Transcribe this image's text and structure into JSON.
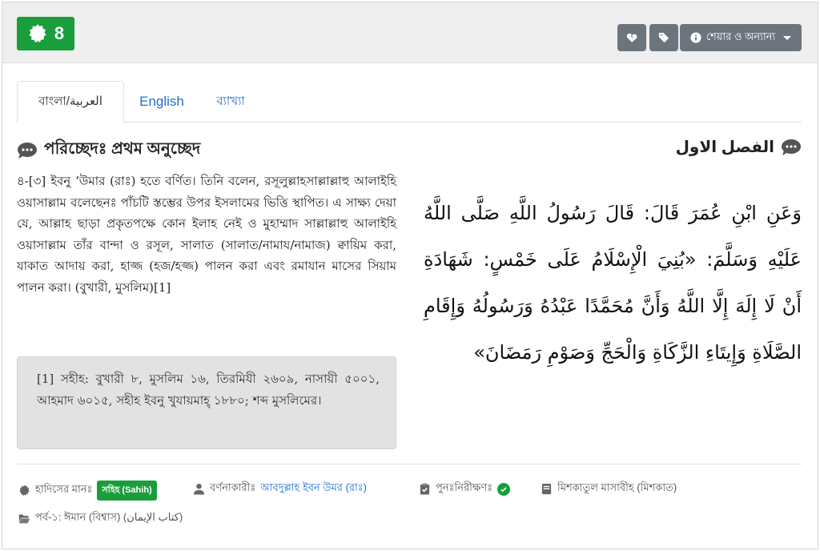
{
  "hadith_number": "8",
  "header_buttons": {
    "share_label": "শেয়ার ও অন্যান্য"
  },
  "tabs": [
    {
      "label": "বাংলা/العربية"
    },
    {
      "label": "English"
    },
    {
      "label": "ব্যাখ্যা"
    }
  ],
  "section": {
    "bn_title": "পরিচ্ছেদঃ প্রথম অনুচ্ছেদ",
    "ar_title": "الفصل الاول"
  },
  "bangla_text": "৪-[৩] ইবনু ‘উমার (রাঃ) হতে বর্ণিত। তিনি বলেন, রসূলুল্লাহসাল্লাল্লাহু আলাইহি ওয়াসাল্লাম বলেছেনঃ পাঁচটি স্তম্ভের উপর ইসলামের ভিত্তি স্থাপিত। এ সাক্ষ্য দেয়া যে, আল্লাহ ছাড়া প্রকৃতপক্ষে কোন ইলাহ নেই ও মুহাম্মাদ সাল্লাল্লাহু আলাইহি ওয়াসাল্লাম তাঁর বান্দা ও রসূল, সালাত (সালাত/নামায/নামাজ) ক্বায়িম করা, যাকাত আদায় করা, হাজ্জ (হজ/হজ্জ) পালন করা এবং রমাযান মাসের সিয়াম পালন করা। (বুখারী, মুসলিম)[1]",
  "footnote": "[1] সহীহ: বুখারী ৮, মুসলিম ১৬, তিরমিযী ২৬০৯, নাসায়ী ৫০০১, আহমাদ ৬০১৫, সহীহ ইবনু খুযায়মাহ্ ১৮৮০; শব্দ মুসলিমের।",
  "arabic_text": "وَعَنِ ابْنِ عُمَرَ قَالَ: قَالَ رَسُولُ اللَّهِ صَلَّى اللَّهُ عَلَيْهِ وَسَلَّمَ: «بُنِيَ الْإِسْلَامُ عَلَى خَمْسٍ: شَهَادَةِ أَنْ لَا إِلَهَ إِلَّا اللَّهُ وَأَنَّ مُحَمَّدًا عَبْدُهُ وَرَسُولُهُ وَإِقَامِ الصَّلَاةِ وَإِيتَاءِ الزَّكَاةِ وَالْحَجِّ وَصَوْمِ رَمَضَانَ»",
  "meta": {
    "grade_label": "হাদিসের মানঃ",
    "grade_badge": "সহিহ (Sahih)",
    "narrator_label": "বর্ণনাকারীঃ",
    "narrator_name": "আবদুল্লাহ ইবন উমর (রাঃ)",
    "review_label": "পুনঃনিরীক্ষণঃ",
    "book": "মিশকাতুল মাসাবীহ (মিশকাত)",
    "chapter": "পর্ব-১: ঈমান (বিশ্বাস) (كتاب الإيمان)"
  },
  "colors": {
    "green": "#1a9e3c",
    "button_gray": "#6c757d",
    "link_blue": "#1f6fd1"
  }
}
